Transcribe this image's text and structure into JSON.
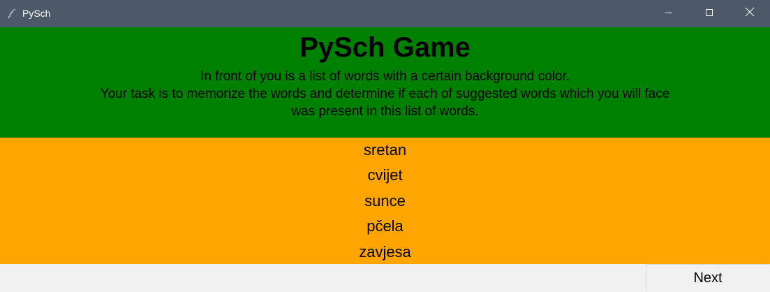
{
  "window": {
    "title": "PySch",
    "titlebar_color": "#4d5868",
    "icons": {
      "app": "feather-icon",
      "minimize": "minimize-icon",
      "maximize": "maximize-icon",
      "close": "close-icon"
    }
  },
  "header": {
    "title": "PySch Game",
    "instructions": [
      "In front of you is a list of words with a certain background color.",
      "Your task is to memorize the words and determine if each of suggested words which you will face",
      "was present in this list of words."
    ],
    "background_color": "#008000"
  },
  "word_list": {
    "background_color": "#ffa500",
    "words": [
      "sretan",
      "cvijet",
      "sunce",
      "pčela",
      "zavjesa"
    ]
  },
  "footer": {
    "next_label": "Next"
  }
}
